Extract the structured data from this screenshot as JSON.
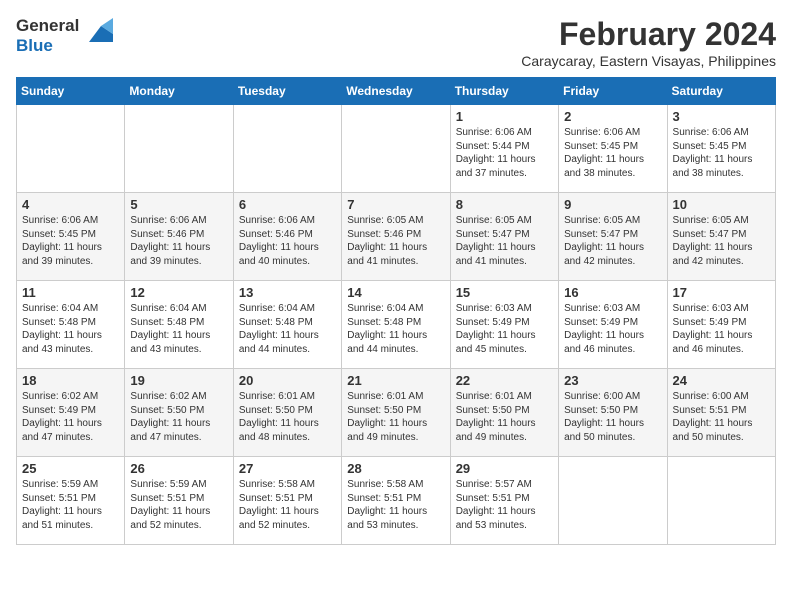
{
  "logo": {
    "text_general": "General",
    "text_blue": "Blue"
  },
  "title": {
    "month_year": "February 2024",
    "location": "Caraycaray, Eastern Visayas, Philippines"
  },
  "days_of_week": [
    "Sunday",
    "Monday",
    "Tuesday",
    "Wednesday",
    "Thursday",
    "Friday",
    "Saturday"
  ],
  "weeks": [
    [
      {
        "day": "",
        "content": ""
      },
      {
        "day": "",
        "content": ""
      },
      {
        "day": "",
        "content": ""
      },
      {
        "day": "",
        "content": ""
      },
      {
        "day": "1",
        "content": "Sunrise: 6:06 AM\nSunset: 5:44 PM\nDaylight: 11 hours\nand 37 minutes."
      },
      {
        "day": "2",
        "content": "Sunrise: 6:06 AM\nSunset: 5:45 PM\nDaylight: 11 hours\nand 38 minutes."
      },
      {
        "day": "3",
        "content": "Sunrise: 6:06 AM\nSunset: 5:45 PM\nDaylight: 11 hours\nand 38 minutes."
      }
    ],
    [
      {
        "day": "4",
        "content": "Sunrise: 6:06 AM\nSunset: 5:45 PM\nDaylight: 11 hours\nand 39 minutes."
      },
      {
        "day": "5",
        "content": "Sunrise: 6:06 AM\nSunset: 5:46 PM\nDaylight: 11 hours\nand 39 minutes."
      },
      {
        "day": "6",
        "content": "Sunrise: 6:06 AM\nSunset: 5:46 PM\nDaylight: 11 hours\nand 40 minutes."
      },
      {
        "day": "7",
        "content": "Sunrise: 6:05 AM\nSunset: 5:46 PM\nDaylight: 11 hours\nand 41 minutes."
      },
      {
        "day": "8",
        "content": "Sunrise: 6:05 AM\nSunset: 5:47 PM\nDaylight: 11 hours\nand 41 minutes."
      },
      {
        "day": "9",
        "content": "Sunrise: 6:05 AM\nSunset: 5:47 PM\nDaylight: 11 hours\nand 42 minutes."
      },
      {
        "day": "10",
        "content": "Sunrise: 6:05 AM\nSunset: 5:47 PM\nDaylight: 11 hours\nand 42 minutes."
      }
    ],
    [
      {
        "day": "11",
        "content": "Sunrise: 6:04 AM\nSunset: 5:48 PM\nDaylight: 11 hours\nand 43 minutes."
      },
      {
        "day": "12",
        "content": "Sunrise: 6:04 AM\nSunset: 5:48 PM\nDaylight: 11 hours\nand 43 minutes."
      },
      {
        "day": "13",
        "content": "Sunrise: 6:04 AM\nSunset: 5:48 PM\nDaylight: 11 hours\nand 44 minutes."
      },
      {
        "day": "14",
        "content": "Sunrise: 6:04 AM\nSunset: 5:48 PM\nDaylight: 11 hours\nand 44 minutes."
      },
      {
        "day": "15",
        "content": "Sunrise: 6:03 AM\nSunset: 5:49 PM\nDaylight: 11 hours\nand 45 minutes."
      },
      {
        "day": "16",
        "content": "Sunrise: 6:03 AM\nSunset: 5:49 PM\nDaylight: 11 hours\nand 46 minutes."
      },
      {
        "day": "17",
        "content": "Sunrise: 6:03 AM\nSunset: 5:49 PM\nDaylight: 11 hours\nand 46 minutes."
      }
    ],
    [
      {
        "day": "18",
        "content": "Sunrise: 6:02 AM\nSunset: 5:49 PM\nDaylight: 11 hours\nand 47 minutes."
      },
      {
        "day": "19",
        "content": "Sunrise: 6:02 AM\nSunset: 5:50 PM\nDaylight: 11 hours\nand 47 minutes."
      },
      {
        "day": "20",
        "content": "Sunrise: 6:01 AM\nSunset: 5:50 PM\nDaylight: 11 hours\nand 48 minutes."
      },
      {
        "day": "21",
        "content": "Sunrise: 6:01 AM\nSunset: 5:50 PM\nDaylight: 11 hours\nand 49 minutes."
      },
      {
        "day": "22",
        "content": "Sunrise: 6:01 AM\nSunset: 5:50 PM\nDaylight: 11 hours\nand 49 minutes."
      },
      {
        "day": "23",
        "content": "Sunrise: 6:00 AM\nSunset: 5:50 PM\nDaylight: 11 hours\nand 50 minutes."
      },
      {
        "day": "24",
        "content": "Sunrise: 6:00 AM\nSunset: 5:51 PM\nDaylight: 11 hours\nand 50 minutes."
      }
    ],
    [
      {
        "day": "25",
        "content": "Sunrise: 5:59 AM\nSunset: 5:51 PM\nDaylight: 11 hours\nand 51 minutes."
      },
      {
        "day": "26",
        "content": "Sunrise: 5:59 AM\nSunset: 5:51 PM\nDaylight: 11 hours\nand 52 minutes."
      },
      {
        "day": "27",
        "content": "Sunrise: 5:58 AM\nSunset: 5:51 PM\nDaylight: 11 hours\nand 52 minutes."
      },
      {
        "day": "28",
        "content": "Sunrise: 5:58 AM\nSunset: 5:51 PM\nDaylight: 11 hours\nand 53 minutes."
      },
      {
        "day": "29",
        "content": "Sunrise: 5:57 AM\nSunset: 5:51 PM\nDaylight: 11 hours\nand 53 minutes."
      },
      {
        "day": "",
        "content": ""
      },
      {
        "day": "",
        "content": ""
      }
    ]
  ]
}
